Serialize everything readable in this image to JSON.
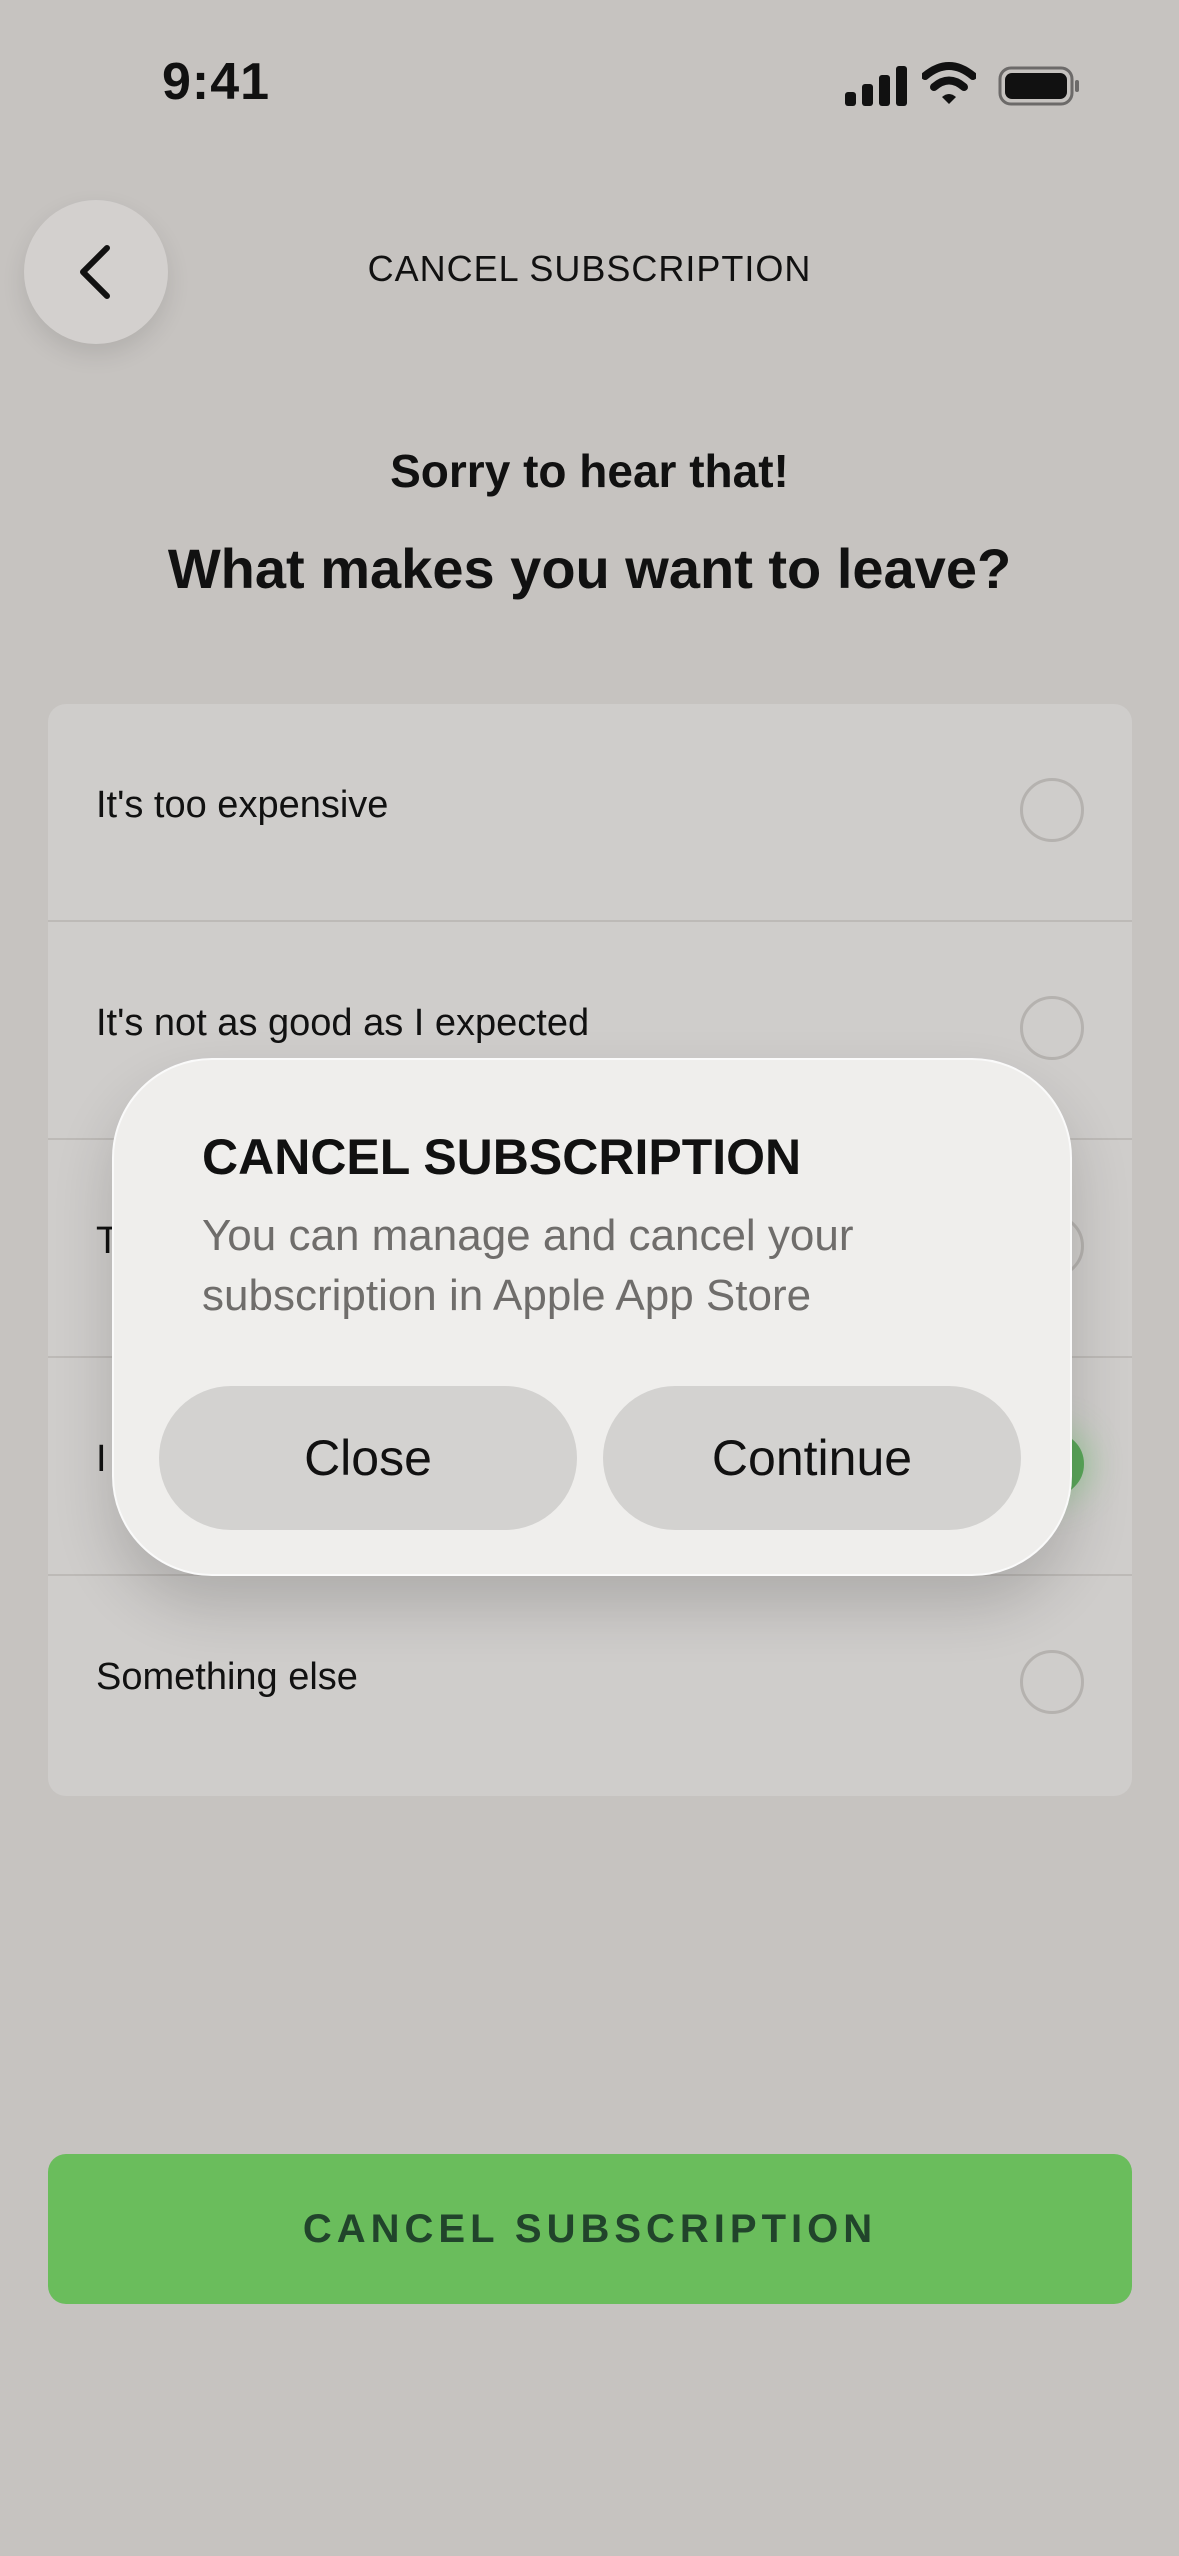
{
  "status_bar": {
    "time": "9:41"
  },
  "header": {
    "title": "CANCEL SUBSCRIPTION",
    "back_icon": "chevron-left-icon"
  },
  "prompt": {
    "subtitle": "Sorry to hear that!",
    "question": "What makes you want to leave?"
  },
  "options": [
    {
      "label": "It's too expensive",
      "selected": false
    },
    {
      "label": "It's not as good as I expected",
      "selected": false
    },
    {
      "label": "T",
      "selected": false
    },
    {
      "label": "I",
      "selected": true
    },
    {
      "label": "Something else",
      "selected": false
    }
  ],
  "dialog": {
    "title": "CANCEL SUBSCRIPTION",
    "message": "You can manage and cancel your subscription in Apple App Store",
    "close_label": "Close",
    "continue_label": "Continue"
  },
  "primary_button": {
    "label": "CANCEL SUBSCRIPTION"
  },
  "colors": {
    "accent": "#6abd5c",
    "selected_radio": "#5aa75a",
    "background": "#c6c3c0"
  }
}
